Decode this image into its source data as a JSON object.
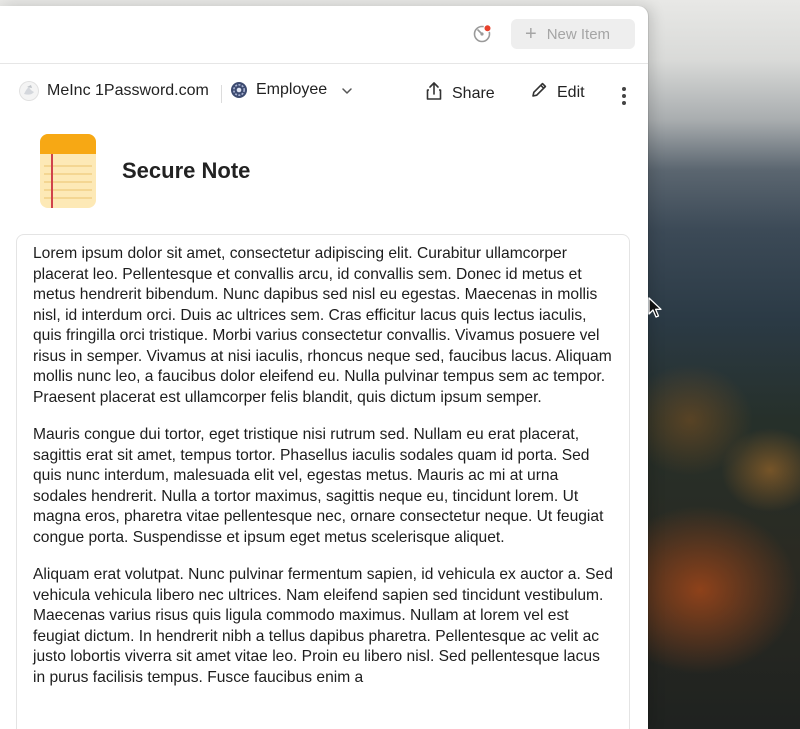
{
  "toolbar_top": {
    "new_item_label": "New Item"
  },
  "item_bar": {
    "vault_name": "MeInc 1Password.com",
    "role_label": "Employee",
    "share_label": "Share",
    "edit_label": "Edit"
  },
  "item": {
    "type": "Secure Note",
    "paragraphs": [
      "Lorem ipsum dolor sit amet, consectetur adipiscing elit. Curabitur ullamcorper placerat leo. Pellentesque et convallis arcu, id convallis sem. Donec id metus et metus hendrerit bibendum. Nunc dapibus sed nisl eu egestas. Maecenas in mollis nisl, id interdum orci. Duis ac ultrices sem. Cras efficitur lacus quis lectus iaculis, quis fringilla orci tristique. Morbi varius consectetur convallis. Vivamus posuere vel risus in semper. Vivamus at nisi iaculis, rhoncus neque sed, faucibus lacus. Aliquam mollis nunc leo, a faucibus dolor eleifend eu. Nulla pulvinar tempus sem ac tempor. Praesent placerat est ullamcorper felis blandit, quis dictum ipsum semper.",
      "Mauris congue dui tortor, eget tristique nisi rutrum sed. Nullam eu erat placerat, sagittis erat sit amet, tempus tortor. Phasellus iaculis sodales quam id porta. Sed quis nunc interdum, malesuada elit vel, egestas metus. Mauris ac mi at urna sodales hendrerit. Nulla a tortor maximus, sagittis neque eu, tincidunt lorem. Ut magna eros, pharetra vitae pellentesque nec, ornare consectetur neque. Ut feugiat congue porta. Suspendisse et ipsum eget metus scelerisque aliquet.",
      "Aliquam erat volutpat. Nunc pulvinar fermentum sapien, id vehicula ex auctor a. Sed vehicula vehicula libero nec ultrices. Nam eleifend sapien sed tincidunt vestibulum. Maecenas varius risus quis ligula commodo maximus. Nullam at lorem vel est feugiat dictum. In hendrerit nibh a tellus dapibus pharetra. Pellentesque ac velit ac justo lobortis viverra sit amet vitae leo. Proin eu libero nisl. Sed pellentesque lacus in purus facilisis tempus. Fusce faucibus enim a"
    ]
  },
  "colors": {
    "notification_dot": "#e8412c",
    "note_icon_yellow": "#f7a814",
    "note_paper": "#fde9b6",
    "note_margin_line": "#d0424b"
  },
  "icons": {
    "watchtower": "watchtower-icon",
    "new_item": "plus-icon",
    "share": "share-icon",
    "edit": "pencil-icon",
    "more": "more-vertical-icon",
    "role": "role-gear-icon",
    "chevron": "chevron-down-icon",
    "note": "secure-note-icon"
  }
}
